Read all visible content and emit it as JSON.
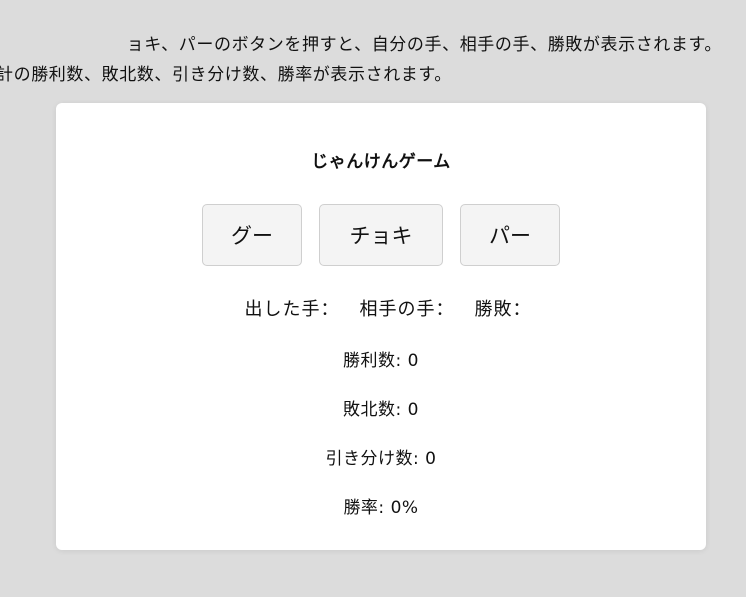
{
  "intro": {
    "line1": "ョキ、パーのボタンを押すと、自分の手、相手の手、勝敗が表示されます。",
    "line2": "計の勝利数、敗北数、引き分け数、勝率が表示されます。"
  },
  "game": {
    "title": "じゃんけんゲーム",
    "buttons": {
      "gu": "グー",
      "choki": "チョキ",
      "pa": "パー"
    },
    "result": {
      "my_hand_label": "出した手：",
      "my_hand_value": "",
      "opponent_hand_label": "相手の手：",
      "opponent_hand_value": "",
      "outcome_label": "勝敗：",
      "outcome_value": ""
    },
    "stats": {
      "wins_label": "勝利数: ",
      "wins": "0",
      "losses_label": "敗北数: ",
      "losses": "0",
      "draws_label": "引き分け数: ",
      "draws": "0",
      "rate_label": "勝率: ",
      "rate": "0%"
    }
  }
}
